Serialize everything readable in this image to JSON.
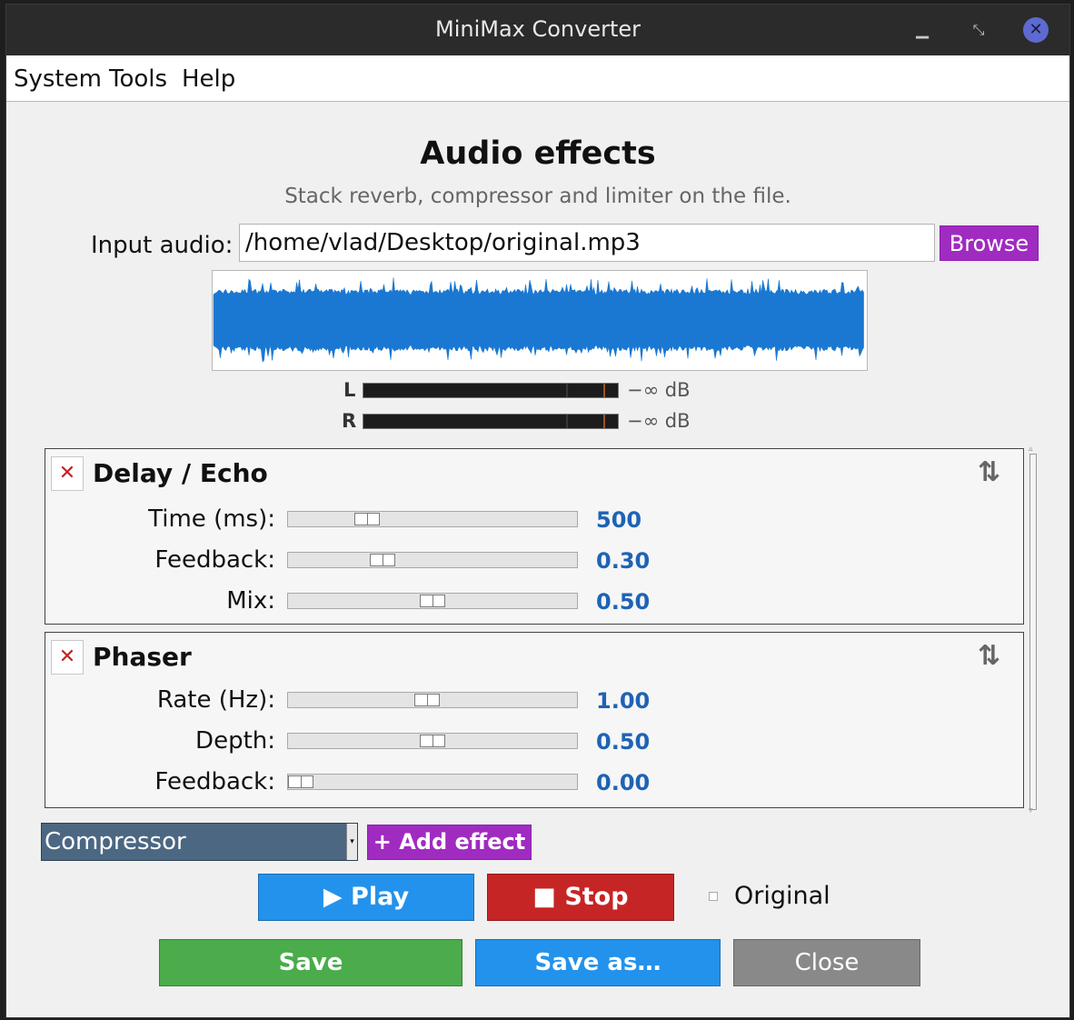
{
  "window": {
    "title": "MiniMax Converter"
  },
  "menu": {
    "items": [
      "System",
      "Tools",
      "Help"
    ]
  },
  "header": {
    "title": "Audio effects",
    "subtitle": "Stack reverb, compressor and limiter on the file."
  },
  "input": {
    "label": "Input audio:",
    "value": "/home/vlad/Desktop/original.mp3",
    "browse_label": "Browse"
  },
  "meters": [
    {
      "channel": "L",
      "readout": "−∞ dB"
    },
    {
      "channel": "R",
      "readout": "−∞ dB"
    }
  ],
  "effects": [
    {
      "name": "Delay / Echo",
      "remove_icon": "✕",
      "reorder_icon": "⇅",
      "params": [
        {
          "label": "Time (ms):",
          "value": "500",
          "position": 0.25
        },
        {
          "label": "Feedback:",
          "value": "0.30",
          "position": 0.31
        },
        {
          "label": "Mix:",
          "value": "0.50",
          "position": 0.5
        }
      ]
    },
    {
      "name": "Phaser",
      "remove_icon": "✕",
      "reorder_icon": "⇅",
      "params": [
        {
          "label": "Rate (Hz):",
          "value": "1.00",
          "position": 0.48
        },
        {
          "label": "Depth:",
          "value": "0.50",
          "position": 0.5
        },
        {
          "label": "Feedback:",
          "value": "0.00",
          "position": 0.0
        }
      ]
    }
  ],
  "effect_picker": {
    "selected": "Compressor",
    "add_label": "+ Add effect"
  },
  "playback": {
    "play_label": "▶ Play",
    "stop_label": "■ Stop",
    "original_label": "Original",
    "original_checked": false
  },
  "actions": {
    "save_label": "Save",
    "save_as_label": "Save as…",
    "close_label": "Close"
  },
  "colors": {
    "accent_purple": "#a02bc0",
    "play_blue": "#2392ec",
    "stop_red": "#c62525",
    "save_green": "#4aac4a",
    "close_gray": "#898989",
    "value_blue": "#1e63b5",
    "waveform": "#1a78d2"
  }
}
